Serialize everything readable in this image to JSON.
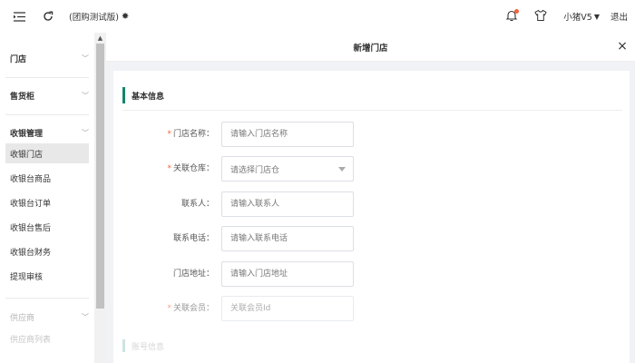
{
  "topbar": {
    "app_title": "(团购测试版)",
    "gear_icon": "gear-icon",
    "user_name": "小猪V5",
    "logout_label": "退出",
    "notification_dot_color": "#f5623b"
  },
  "sidebar": {
    "groups": [
      {
        "label": "门店"
      },
      {
        "label": "售货柜"
      },
      {
        "label": "收银管理"
      },
      {
        "label": "供应商"
      }
    ],
    "cashier_items": [
      {
        "label": "收银门店",
        "active": true
      },
      {
        "label": "收银台商品"
      },
      {
        "label": "收银台订单"
      },
      {
        "label": "收银台售后"
      },
      {
        "label": "收银台财务"
      },
      {
        "label": "提现审核"
      }
    ],
    "supplier_items": [
      {
        "label": "供应商列表"
      }
    ]
  },
  "panel": {
    "title": "新增门店",
    "section_basic": "基本信息",
    "section_account": "账号信息",
    "accent_color": "#14856a"
  },
  "form": {
    "store_name": {
      "label": "门店名称：",
      "required": true,
      "placeholder": "请输入门店名称"
    },
    "warehouse": {
      "label": "关联仓库：",
      "required": true,
      "placeholder": "请选择门店仓"
    },
    "contact": {
      "label": "联系人：",
      "required": false,
      "placeholder": "请输入联系人"
    },
    "phone": {
      "label": "联系电话：",
      "required": false,
      "placeholder": "请输入联系电话"
    },
    "address": {
      "label": "门店地址：",
      "required": false,
      "placeholder": "请输入门店地址"
    },
    "member": {
      "label": "关联会员：",
      "required": true,
      "placeholder": "关联会员Id"
    },
    "required_mark": "*"
  }
}
